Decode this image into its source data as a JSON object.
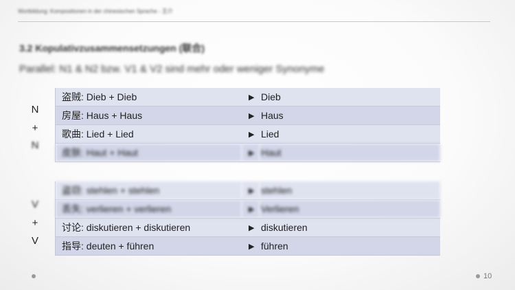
{
  "header": {
    "running_title": "Wortbildung: Kompositionen in der chinesischen Sprache - 王介"
  },
  "section": {
    "title": "3.2 Kopulativzusammensetzungen (联合)",
    "subtitle": "Parallel: N1 & N2 bzw. V1 & V2 sind mehr oder weniger Synonyme"
  },
  "groups": {
    "noun": {
      "top": "N",
      "mid": "+",
      "bottom": "N"
    },
    "verb": {
      "top": "V",
      "mid": "+",
      "bottom": "V"
    }
  },
  "arrow_glyph": "▶",
  "noun_rows": [
    {
      "compound": "盗贼: Dieb + Dieb",
      "meaning": "Dieb"
    },
    {
      "compound": "房屋: Haus + Haus",
      "meaning": "Haus"
    },
    {
      "compound": "歌曲: Lied + Lied",
      "meaning": "Lied"
    },
    {
      "compound": "皮肤: Haut + Haut",
      "meaning": "Haut"
    }
  ],
  "verb_rows": [
    {
      "compound": "盗窃: stehlen + stehlen",
      "meaning": "stehlen"
    },
    {
      "compound": "丢失: verlieren + verlieren",
      "meaning": "Verlieren"
    },
    {
      "compound": "讨论: diskutieren + diskutieren",
      "meaning": "diskutieren"
    },
    {
      "compound": "指导: deuten + führen",
      "meaning": "führen"
    }
  ],
  "footer": {
    "page_number": "10"
  },
  "colors": {
    "row_light": "#dfe2ef",
    "row_dark": "#d2d6e8",
    "border": "#c4c7d6"
  }
}
